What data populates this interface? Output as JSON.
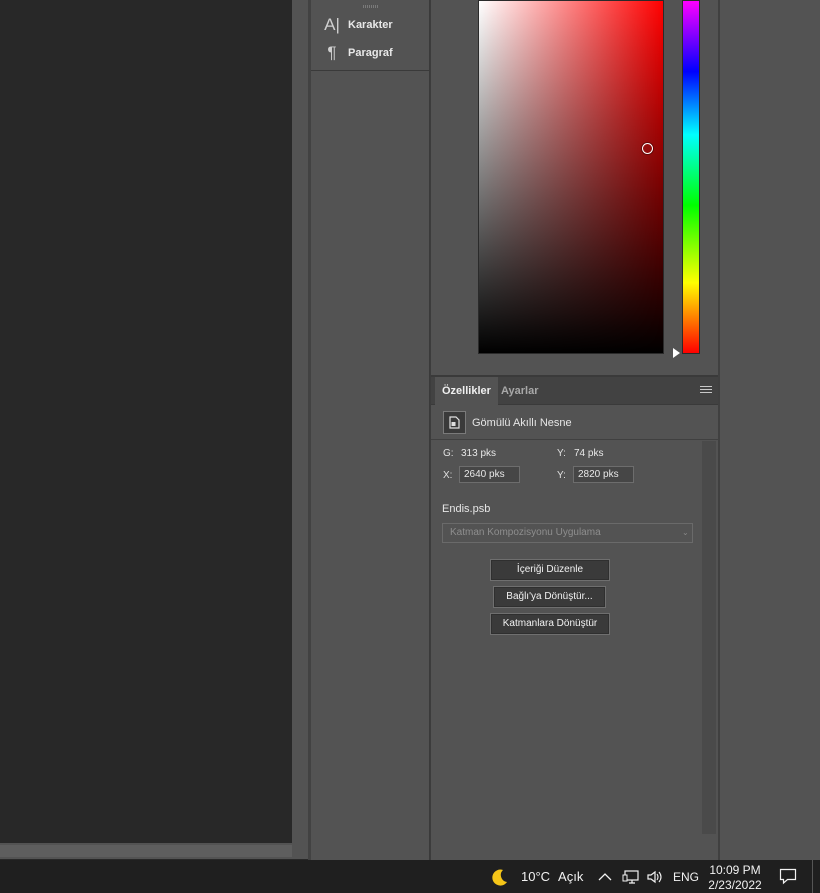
{
  "dock": {
    "items": [
      {
        "icon": "character-icon",
        "glyph": "A|",
        "label": "Karakter"
      },
      {
        "icon": "paragraph-icon",
        "glyph": "¶",
        "label": "Paragraf"
      }
    ]
  },
  "properties": {
    "tabs": [
      {
        "label": "Özellikler",
        "active": true
      },
      {
        "label": "Ayarlar",
        "active": false
      }
    ],
    "object_type": "Gömülü Akıllı Nesne",
    "width_label": "G:",
    "width_value": "313 pks",
    "height_label": "Y:",
    "height_value": "74 pks",
    "x_label": "X:",
    "x_value": "2640 pks",
    "y_label": "Y:",
    "y_value": "2820 pks",
    "file_name": "Endis.psb",
    "layer_comp_placeholder": "Katman Kompozisyonu Uygulama",
    "buttons": {
      "edit_contents": "İçeriği Düzenle",
      "convert_linked": "Bağlı'ya Dönüştür...",
      "convert_layers": "Katmanlara Dönüştür"
    }
  },
  "taskbar": {
    "weather_icon": "moon-icon",
    "temperature": "10°C",
    "weather_text": "Açık",
    "language": "ENG",
    "time": "10:09 PM",
    "date": "2/23/2022"
  }
}
